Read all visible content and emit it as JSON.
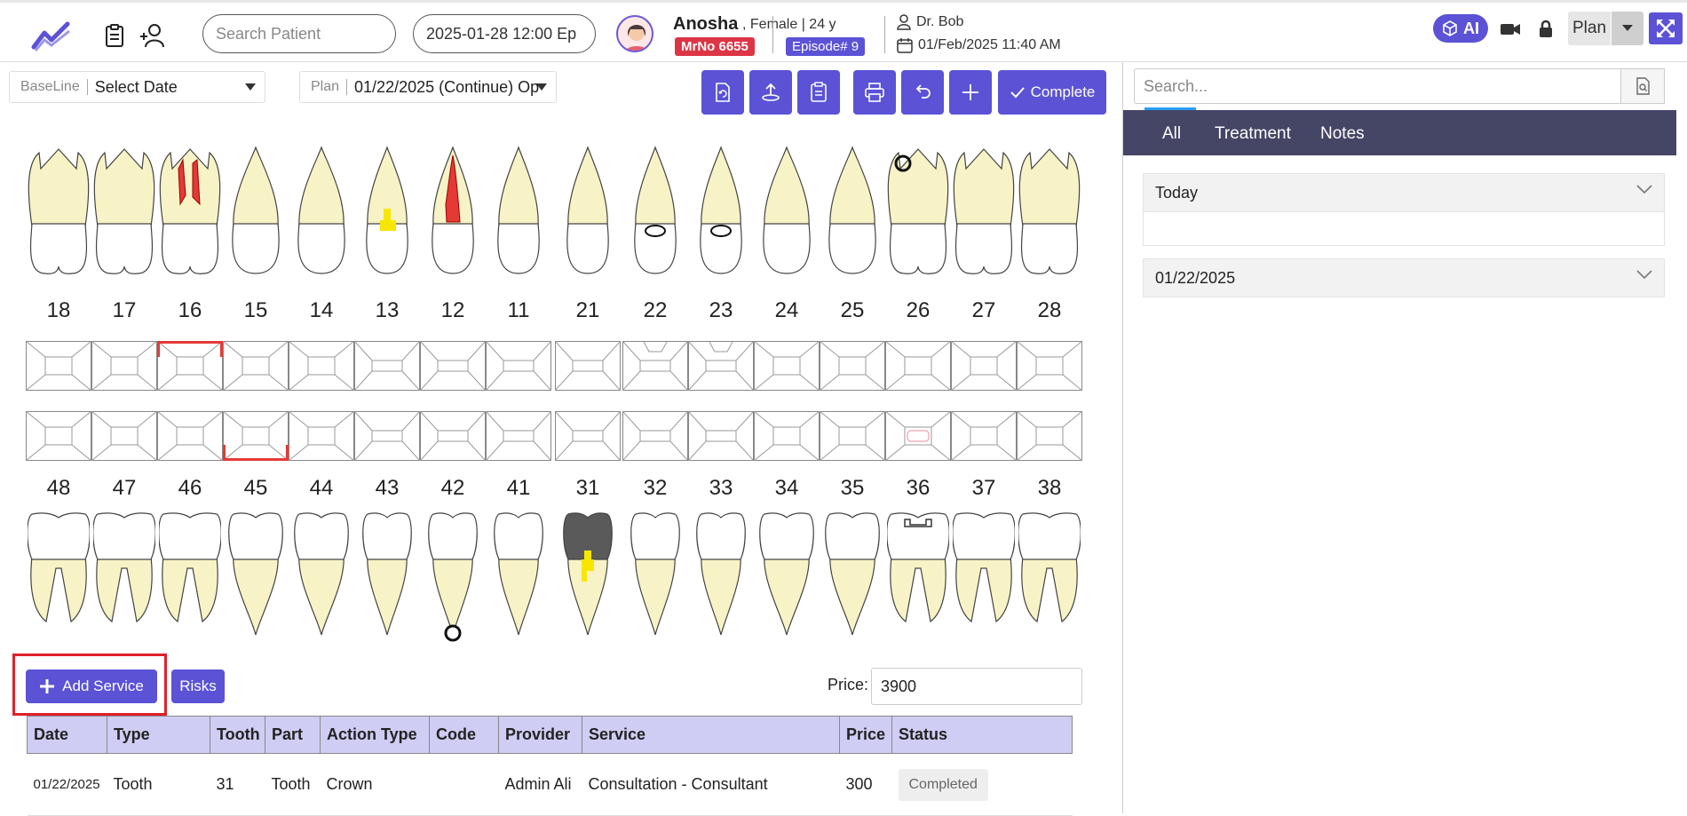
{
  "header": {
    "search_placeholder": "Search Patient",
    "datetime_field": "2025-01-28 12:00 Ep",
    "patient": {
      "name": "Anosha",
      "meta": ", Female | 24 y",
      "mrno": "MrNo 6655",
      "episode": "Episode# 9"
    },
    "doctor": "Dr. Bob",
    "appointment": "01/Feb/2025 11:40 AM",
    "ai_label": "AI",
    "plan_label": "Plan"
  },
  "toolbar": {
    "baseline_label": "BaseLine",
    "baseline_value": "Select Date",
    "plan_label": "Plan",
    "plan_value": "01/22/2025 (Continue) Op",
    "complete_label": "Complete"
  },
  "chart": {
    "upper_numbers": [
      "18",
      "17",
      "16",
      "15",
      "14",
      "13",
      "12",
      "11",
      "21",
      "22",
      "23",
      "24",
      "25",
      "26",
      "27",
      "28"
    ],
    "lower_numbers": [
      "48",
      "47",
      "46",
      "45",
      "44",
      "43",
      "42",
      "41",
      "31",
      "32",
      "33",
      "34",
      "35",
      "36",
      "37",
      "38"
    ]
  },
  "services": {
    "add_label": "Add Service",
    "risks_label": "Risks",
    "price_label": "Price:",
    "price_value": "3900",
    "columns": [
      "Date",
      "Type",
      "Tooth",
      "Part",
      "Action Type",
      "Code",
      "Provider",
      "Service",
      "Price",
      "Status"
    ],
    "rows": [
      {
        "date": "01/22/2025",
        "type": "Tooth",
        "tooth": "31",
        "part": "Tooth",
        "action": "Crown",
        "code": "",
        "provider": "Admin Ali",
        "service": "Consultation - Consultant",
        "price": "300",
        "status": "Completed"
      }
    ]
  },
  "right_panel": {
    "search_placeholder": "Search...",
    "tabs": [
      "All",
      "Treatment",
      "Notes"
    ],
    "active_tab": "All",
    "sections": [
      "Today",
      "01/22/2025"
    ]
  },
  "colors": {
    "accent": "#5b52d6",
    "danger": "#dc3545",
    "tab_bar": "#454566",
    "table_header": "#cfcdf3",
    "root": "#f7f3c6",
    "caries": "#e53935",
    "filling": "#f7e600",
    "crown": "#5a5a5a"
  }
}
